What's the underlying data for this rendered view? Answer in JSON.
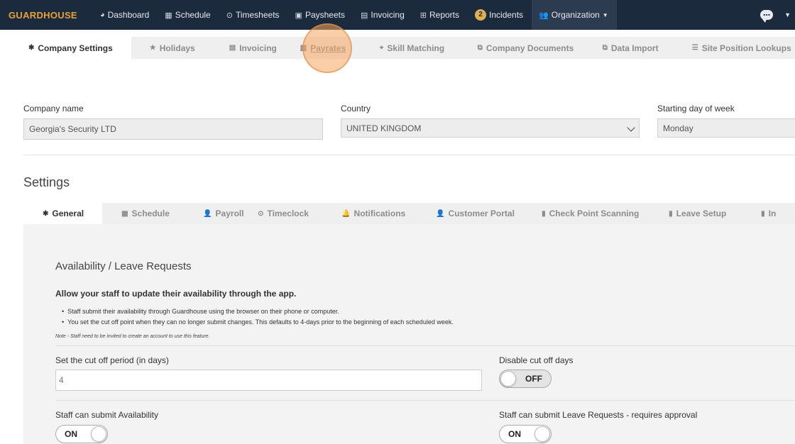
{
  "navbar": {
    "brand": "GUARDHOUSE",
    "items": [
      {
        "label": "Dashboard",
        "icon": "dashboard-icon"
      },
      {
        "label": "Schedule",
        "icon": "calendar-icon"
      },
      {
        "label": "Timesheets",
        "icon": "clock-icon"
      },
      {
        "label": "Paysheets",
        "icon": "money-icon"
      },
      {
        "label": "Invoicing",
        "icon": "invoice-icon"
      },
      {
        "label": "Reports",
        "icon": "table-icon"
      }
    ],
    "incidents_count": "2",
    "incidents_label": "Incidents",
    "organization_label": "Organization"
  },
  "top_tabs": [
    {
      "label": "Company Settings",
      "icon": "gear-icon"
    },
    {
      "label": "Holidays",
      "icon": "star-icon"
    },
    {
      "label": "Invoicing",
      "icon": "list-icon"
    },
    {
      "label": "Payrates",
      "icon": "calendar-icon"
    },
    {
      "label": "Skill Matching",
      "icon": "crosshair-icon"
    },
    {
      "label": "Company Documents",
      "icon": "copy-icon"
    },
    {
      "label": "Data Import",
      "icon": "copy-icon"
    },
    {
      "label": "Site Position Lookups",
      "icon": "list-icon"
    }
  ],
  "company": {
    "name_label": "Company name",
    "name_value": "Georgia's Security LTD",
    "country_label": "Country",
    "country_value": "UNITED KINGDOM",
    "start_day_label": "Starting day of week",
    "start_day_value": "Monday"
  },
  "settings_title": "Settings",
  "settings_tabs": [
    {
      "label": "General",
      "icon": "gear-icon"
    },
    {
      "label": "Schedule",
      "icon": "calendar-icon"
    },
    {
      "label": "Payroll",
      "icon": "user-icon"
    },
    {
      "label": "Timeclock",
      "icon": "clock-icon"
    },
    {
      "label": "Notifications",
      "icon": "bell-icon"
    },
    {
      "label": "Customer Portal",
      "icon": "user-icon"
    },
    {
      "label": "Check Point Scanning",
      "icon": "file-icon"
    },
    {
      "label": "Leave Setup",
      "icon": "file-icon"
    },
    {
      "label": "In",
      "icon": "file-icon"
    }
  ],
  "panel": {
    "heading": "Availability / Leave Requests",
    "subheading": "Allow your staff to update their availability through the app.",
    "bullets": [
      "Staff submit their availability through Guardhouse using the browser on their phone or computer.",
      "You set the cut off point when they can no longer submit changes. This defaults to 4-days prior to the beginning of each scheduled week."
    ],
    "note": "Note - Staff need to be invited to create an account to use this feature.",
    "cutoff_label": "Set the cut off period (in days)",
    "cutoff_value": "4",
    "disable_label": "Disable cut off days",
    "disable_state": "OFF",
    "availability_label": "Staff can submit Availability",
    "availability_state": "ON",
    "leave_label": "Staff can submit Leave Requests - requires approval",
    "leave_state": "ON"
  }
}
